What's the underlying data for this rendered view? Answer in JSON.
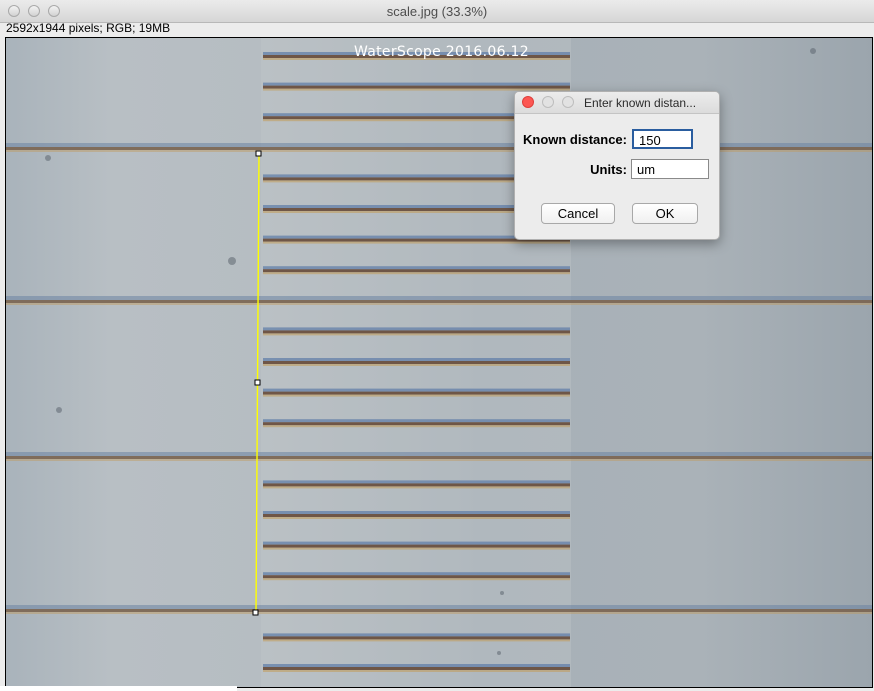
{
  "window": {
    "title": "scale.jpg (33.3%)",
    "info": "2592x1944 pixels; RGB; 19MB"
  },
  "image": {
    "watermark": "WaterScope 2016.06.12"
  },
  "dialog": {
    "title": "Enter known distan...",
    "known_distance_label": "Known distance:",
    "known_distance_value": "150",
    "units_label": "Units:",
    "units_value": "um",
    "cancel_label": "Cancel",
    "ok_label": "OK"
  },
  "colors": {
    "close_red": "#fc5753",
    "selection_line": "#ffff00",
    "focus_ring": "#2a5d9f"
  }
}
